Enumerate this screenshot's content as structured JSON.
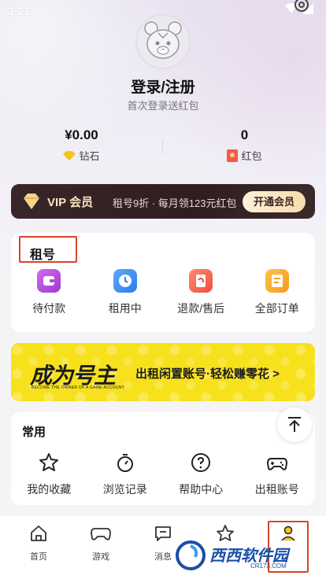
{
  "status_bar": {
    "time": "3:21"
  },
  "profile": {
    "login_title": "登录/注册",
    "login_sub": "首次登录送红包"
  },
  "wallet": {
    "diamond_value": "¥0.00",
    "diamond_label": "钻石",
    "redpack_value": "0",
    "redpack_label": "红包"
  },
  "vip": {
    "title": "VIP 会员",
    "desc": "租号9折 · 每月领123元红包",
    "button": "开通会员"
  },
  "rent": {
    "title": "租号",
    "items": [
      {
        "label": "待付款",
        "icon": "wallet-icon",
        "color": "#b04bd8"
      },
      {
        "label": "租用中",
        "icon": "clock-icon",
        "color": "#3b8cf0"
      },
      {
        "label": "退款/售后",
        "icon": "refund-icon",
        "color": "#f0604a"
      },
      {
        "label": "全部订单",
        "icon": "orders-icon",
        "color": "#f5a623"
      }
    ]
  },
  "banner": {
    "title": "成为号主",
    "sub_en": "BECOME THE OWNER OF A GAME ACCOUNT",
    "text": "出租闲置账号·轻松赚零花 >"
  },
  "common": {
    "title": "常用",
    "items": [
      {
        "label": "我的收藏",
        "icon": "star-icon"
      },
      {
        "label": "浏览记录",
        "icon": "stopwatch-icon"
      },
      {
        "label": "帮助中心",
        "icon": "help-icon"
      },
      {
        "label": "出租账号",
        "icon": "gamepad-icon"
      }
    ]
  },
  "tabbar": {
    "items": [
      {
        "label": "首页",
        "icon": "home-icon"
      },
      {
        "label": "游戏",
        "icon": "gamepad-icon"
      },
      {
        "label": "消息",
        "icon": "message-icon"
      },
      {
        "label": "",
        "icon": "star-icon"
      },
      {
        "label": "",
        "icon": "user-icon"
      }
    ]
  },
  "watermark": {
    "brand": "西西软件园",
    "url": "CR173.COM"
  },
  "colors": {
    "highlight_border": "#d9432c",
    "vip_bg": "#2e1e22",
    "banner_yellow": "#f7e11c"
  }
}
